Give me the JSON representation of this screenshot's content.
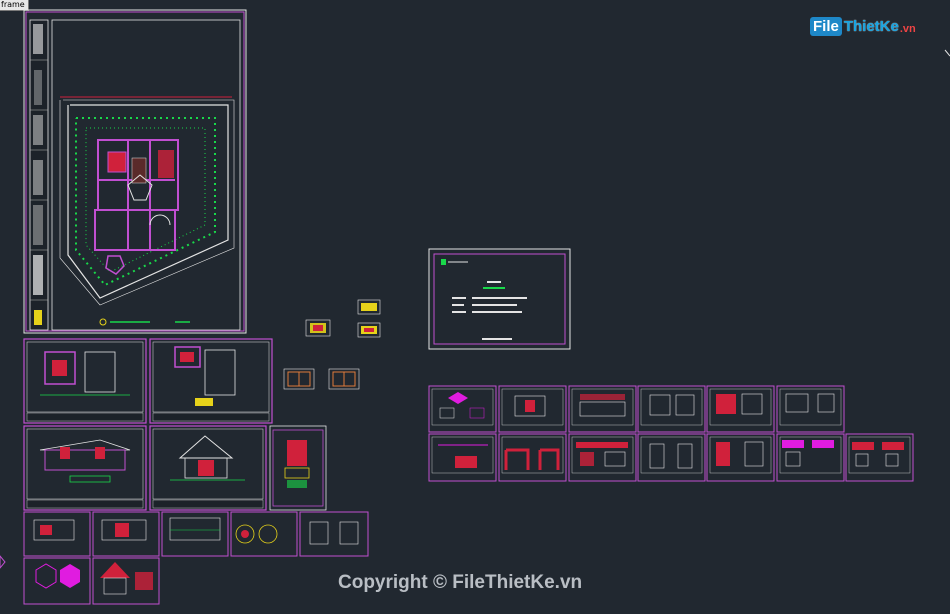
{
  "frame_label": "frame",
  "watermark": {
    "logo_prefix": "File",
    "logo_main": "ThietKe",
    "logo_suffix": ".vn",
    "copyright": "Copyright © FileThietKe.vn"
  },
  "colors": {
    "background": "#212830",
    "sheet_border": "#c14fd1",
    "white_frame": "#e4e4e4",
    "green_line": "#19d84a",
    "red_fill": "#d0213b",
    "magenta": "#e01ce0",
    "yellow": "#e6d21a",
    "cyan": "#28c7d4"
  },
  "icons": [
    "left-marker-icon",
    "logo-icon"
  ]
}
